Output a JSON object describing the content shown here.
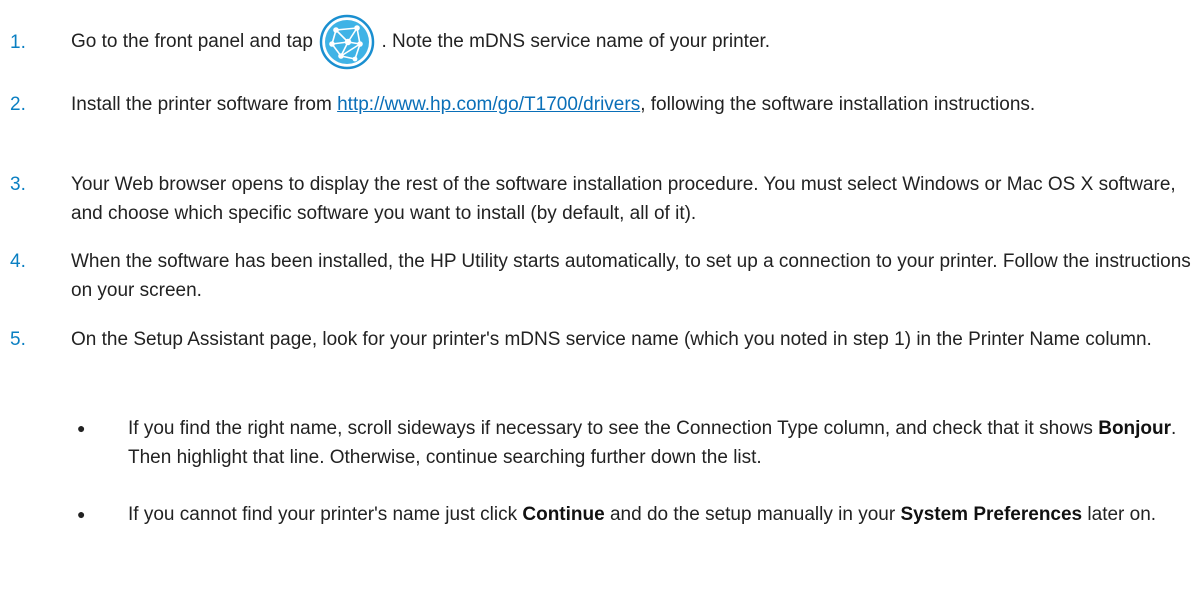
{
  "steps": [
    {
      "number": "1.",
      "before_icon": "Go to the front panel and tap",
      "icon": "network-globe-icon",
      "after_icon": ". Note the mDNS service name of your printer."
    },
    {
      "number": "2.",
      "before_link": "Install the printer software from ",
      "link": "http://www.hp.com/go/T1700/drivers",
      "after_link": ", following the software installation instructions."
    },
    {
      "number": "3.",
      "text": "Your Web browser opens to display the rest of the software installation procedure. You must select Windows or Mac OS X software, and choose which specific software you want to install (by default, all of it)."
    },
    {
      "number": "4.",
      "text": "When the software has been installed, the HP Utility starts automatically, to set up a connection to your printer. Follow the instructions on your screen."
    },
    {
      "number": "5.",
      "text": "On the Setup Assistant page, look for your printer's mDNS service name (which you noted in step 1) in the Printer Name column."
    }
  ],
  "bullets": [
    {
      "symbol": "●",
      "part1": "If you find the right name, scroll sideways if necessary to see the Connection Type column, and check that it shows ",
      "bold1": "Bonjour",
      "part2": ". Then highlight that line. Otherwise, continue searching further down the list."
    },
    {
      "symbol": "●",
      "part1": "If you cannot find your printer's name just click ",
      "bold1": "Continue",
      "part2": " and do the setup manually in your ",
      "bold2": "System Preferences",
      "part3": " later on."
    }
  ],
  "colors": {
    "step_number": "#0a7fc2",
    "link": "#0a6fb8",
    "icon_fill": "#3fb3e6",
    "icon_ring": "#1a8fd0"
  }
}
